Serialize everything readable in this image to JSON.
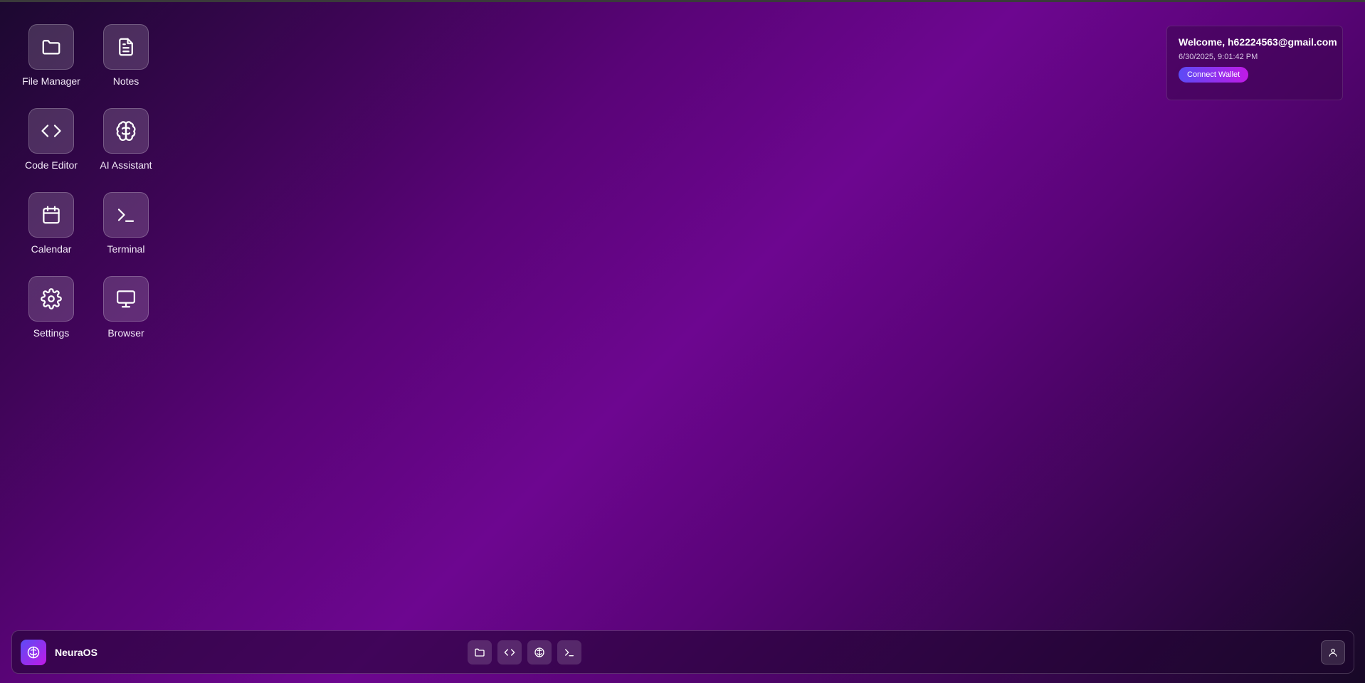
{
  "desktop": {
    "apps": [
      {
        "label": "File Manager",
        "icon": "folder-icon"
      },
      {
        "label": "Notes",
        "icon": "document-icon"
      },
      {
        "label": "Code Editor",
        "icon": "code-icon"
      },
      {
        "label": "AI Assistant",
        "icon": "brain-icon"
      },
      {
        "label": "Calendar",
        "icon": "calendar-icon"
      },
      {
        "label": "Terminal",
        "icon": "terminal-icon"
      },
      {
        "label": "Settings",
        "icon": "gear-icon"
      },
      {
        "label": "Browser",
        "icon": "monitor-icon"
      }
    ]
  },
  "welcome": {
    "title": "Welcome, h62224563@gmail.com",
    "datetime": "6/30/2025, 9:01:42 PM",
    "connect_label": "Connect Wallet"
  },
  "taskbar": {
    "brand": "NeuraOS",
    "brand_icon": "brain-icon",
    "dock": [
      {
        "icon": "folder-icon"
      },
      {
        "icon": "code-icon"
      },
      {
        "icon": "brain-icon"
      },
      {
        "icon": "terminal-icon"
      }
    ],
    "user_icon": "user-icon"
  },
  "colors": {
    "accent_start": "#5b4bf6",
    "accent_end": "#c11ae6",
    "background_mid": "#6d0690"
  }
}
